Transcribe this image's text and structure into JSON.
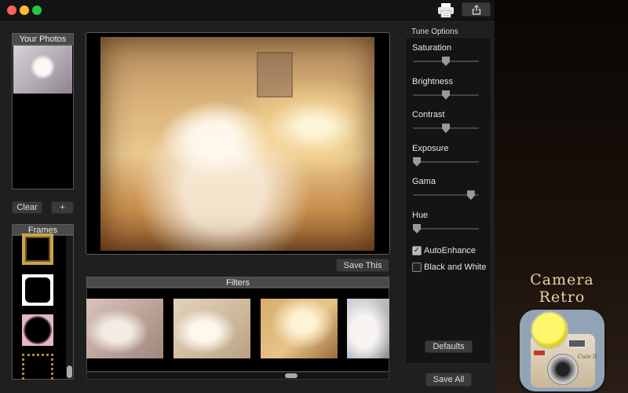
{
  "photos": {
    "title": "Your Photos",
    "clear_label": "Clear",
    "add_label": "+"
  },
  "frames": {
    "title": "Frames"
  },
  "main": {
    "save_this_label": "Save This"
  },
  "filters": {
    "title": "Filters"
  },
  "tune": {
    "title": "Tune Options",
    "sliders": [
      {
        "label": "Saturation",
        "value": 0.5
      },
      {
        "label": "Brightness",
        "value": 0.5
      },
      {
        "label": "Contrast",
        "value": 0.5
      },
      {
        "label": "Exposure",
        "value": 0.0
      },
      {
        "label": "Gama",
        "value": 0.93
      },
      {
        "label": "Hue",
        "value": 0.0
      }
    ],
    "auto_enhance": {
      "label": "AutoEnhance",
      "checked": true
    },
    "black_white": {
      "label": "Black and White",
      "checked": false
    },
    "defaults_label": "Defaults"
  },
  "save_all_label": "Save All",
  "app": {
    "name_line1": "Camera",
    "name_line2": "Retro",
    "camera_model": "Cute II"
  },
  "colors": {
    "close": "#fe5f57",
    "minimize": "#febc2e",
    "maximize": "#28c840",
    "accent": "#e8d3a3"
  },
  "icons": {
    "print": "printer-icon",
    "share": "share-icon",
    "check": "✓"
  }
}
